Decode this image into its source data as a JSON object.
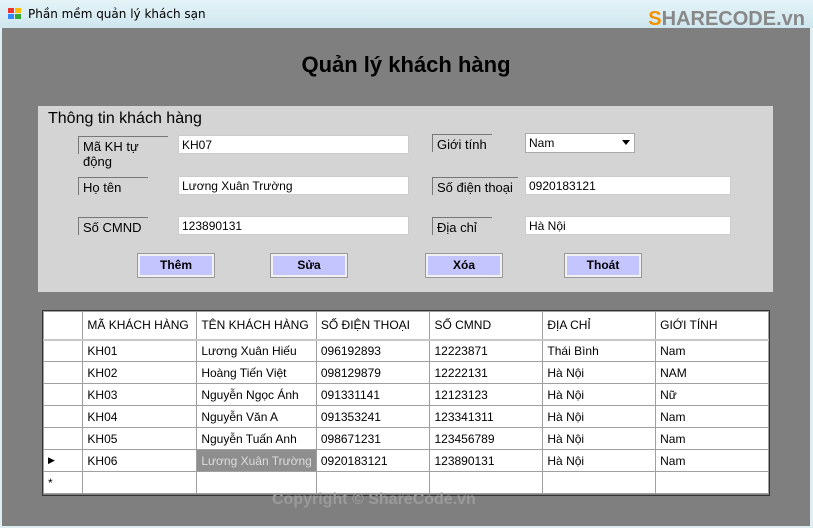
{
  "window": {
    "title": "Phần mềm quản lý khách sạn",
    "logo": "SHARECODE.vn"
  },
  "heading": "Quản lý khách hàng",
  "panel": {
    "title": "Thông tin khách hàng",
    "fields": {
      "ma_label": "Mã KH tự động",
      "ma_value": "KH07",
      "hoten_label": "Họ tên",
      "hoten_value": "Lương Xuân Trường",
      "cmnd_label": "Số CMND",
      "cmnd_value": "123890131",
      "gioitinh_label": "Giới tính",
      "gioitinh_value": "Nam",
      "sdt_label": "Số điện thoại",
      "sdt_value": "0920183121",
      "diachi_label": "Địa chỉ",
      "diachi_value": "Hà Nội"
    },
    "buttons": {
      "them": "Thêm",
      "sua": "Sửa",
      "xoa": "Xóa",
      "thoat": "Thoát"
    },
    "accent": "#c4c4ff"
  },
  "grid": {
    "headers": [
      "MÃ KHÁCH HÀNG",
      "TÊN KHÁCH HÀNG",
      "SỐ ĐIỆN THOẠI",
      "SỐ CMND",
      "ĐỊA CHỈ",
      "GIỚI TÍNH"
    ],
    "rows": [
      [
        "KH01",
        "Lương Xuân Hiếu",
        "096192893",
        "12223871",
        "Thái Bình",
        "Nam"
      ],
      [
        "KH02",
        "Hoàng Tiến Việt",
        "098129879",
        "12222131",
        "Hà Nội",
        "NAM"
      ],
      [
        "KH03",
        "Nguyễn Ngọc Ánh",
        "091331141",
        "12123123",
        "Hà Nội",
        "Nữ"
      ],
      [
        "KH04",
        "Nguyễn Văn A",
        "091353241",
        "123341311",
        "Hà Nội",
        "Nam"
      ],
      [
        "KH05",
        "Nguyễn Tuấn Anh",
        "098671231",
        "123456789",
        "Hà Nội",
        "Nam"
      ],
      [
        "KH06",
        "Lương Xuân Trường",
        "0920183121",
        "123890131",
        "Hà Nội",
        "Nam"
      ]
    ],
    "current_marker": "▶",
    "new_row_marker": "*"
  },
  "footer": "Copyright © ShareCode.vn"
}
